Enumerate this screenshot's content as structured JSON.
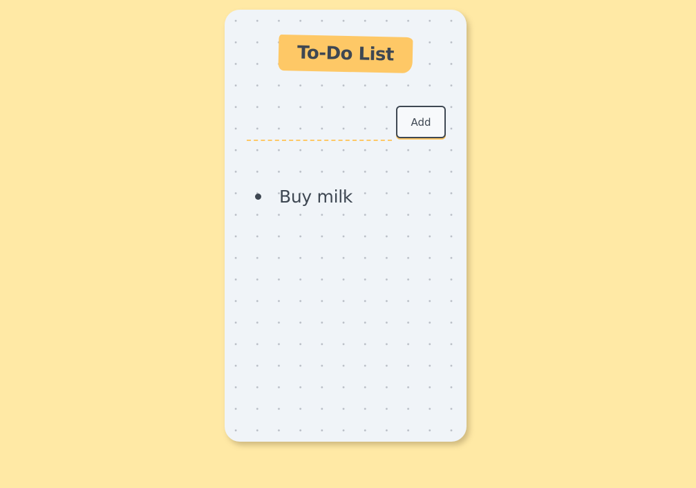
{
  "app": {
    "title": "To-Do List"
  },
  "form": {
    "input_value": "",
    "input_placeholder": "",
    "add_label": "Add"
  },
  "tasks": [
    {
      "text": "Buy milk"
    }
  ],
  "colors": {
    "background": "#ffe9a5",
    "card": "#f0f4f8",
    "accent": "#fec866",
    "text": "#3e4752"
  }
}
